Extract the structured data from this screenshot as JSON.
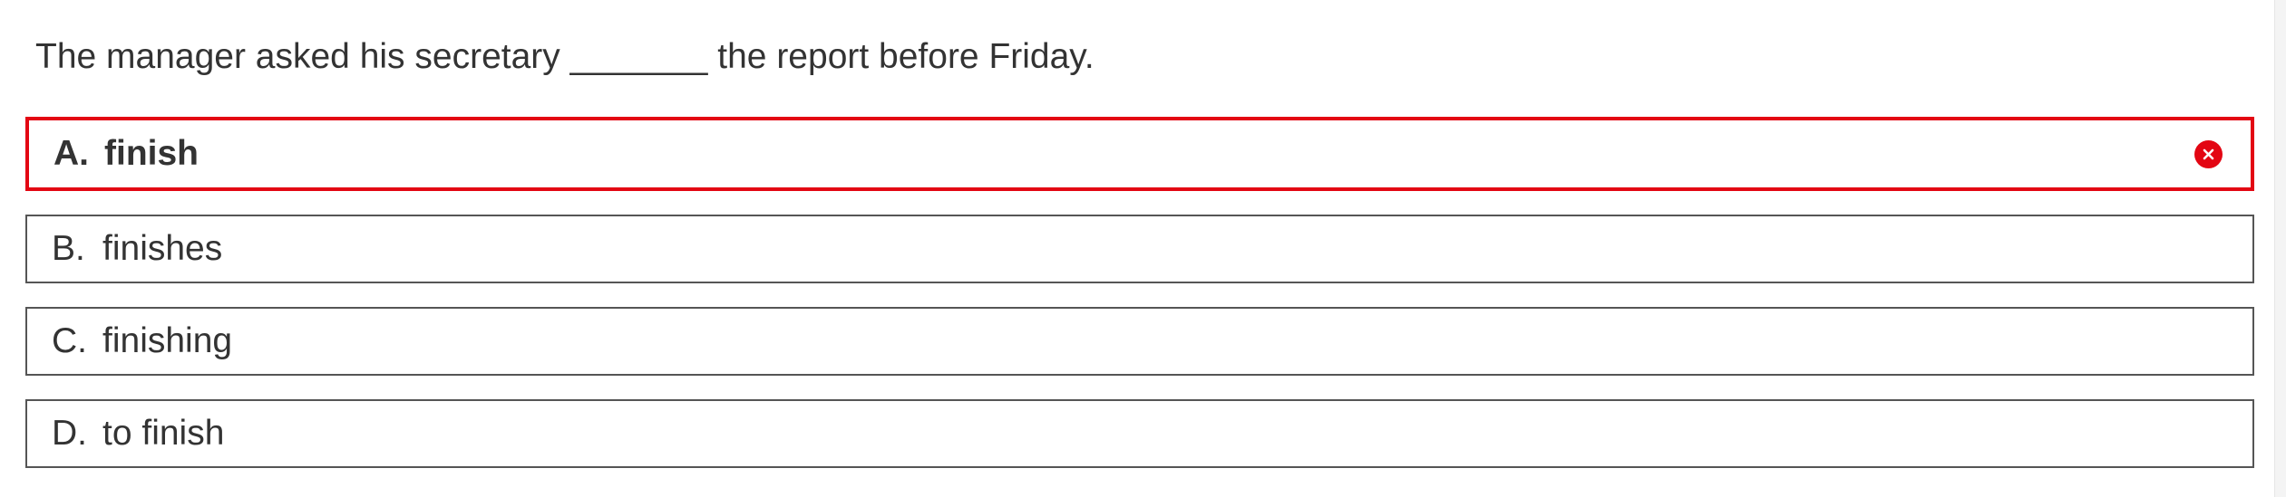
{
  "question": {
    "text": "The manager asked his secretary _______ the report before Friday."
  },
  "options": [
    {
      "letter": "A.",
      "text": "finish",
      "state": "selected-incorrect",
      "icon": "close-circle-icon"
    },
    {
      "letter": "B.",
      "text": "finishes",
      "state": "unselected"
    },
    {
      "letter": "C.",
      "text": "finishing",
      "state": "unselected"
    },
    {
      "letter": "D.",
      "text": "to finish",
      "state": "unselected"
    }
  ],
  "colors": {
    "incorrect": "#e30613",
    "text": "#333333",
    "border": "#555555"
  }
}
